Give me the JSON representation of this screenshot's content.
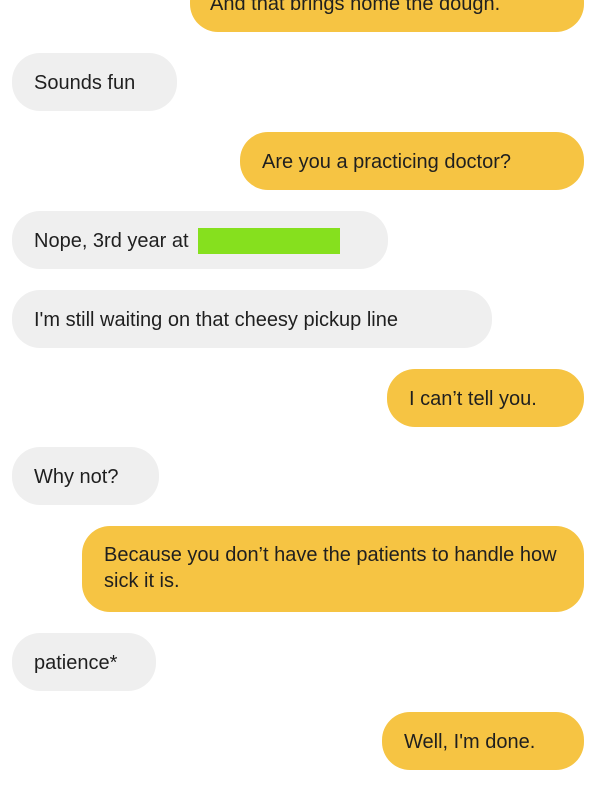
{
  "conversation": {
    "messages": [
      {
        "id": "m1",
        "sender": "me",
        "text": "And that brings home the dough."
      },
      {
        "id": "m2",
        "sender": "them",
        "text": "Sounds fun"
      },
      {
        "id": "m3",
        "sender": "me",
        "text": "Are you a practicing doctor?"
      },
      {
        "id": "m4",
        "sender": "them",
        "text": "Nope, 3rd year at"
      },
      {
        "id": "m5",
        "sender": "them",
        "text": "I'm still waiting on that cheesy pickup line"
      },
      {
        "id": "m6",
        "sender": "me",
        "text": "I can’t tell you."
      },
      {
        "id": "m7",
        "sender": "them",
        "text": "Why not?"
      },
      {
        "id": "m8",
        "sender": "me",
        "text": "Because you don’t have the patients to handle how sick it is."
      },
      {
        "id": "m9",
        "sender": "them",
        "text": "patience*"
      },
      {
        "id": "m10",
        "sender": "me",
        "text": "Well, I'm done."
      }
    ]
  },
  "colors": {
    "sent_bubble": "#f6c443",
    "received_bubble": "#efefef",
    "redaction": "#86e01e",
    "text": "#1f1f1f",
    "background": "#ffffff"
  }
}
